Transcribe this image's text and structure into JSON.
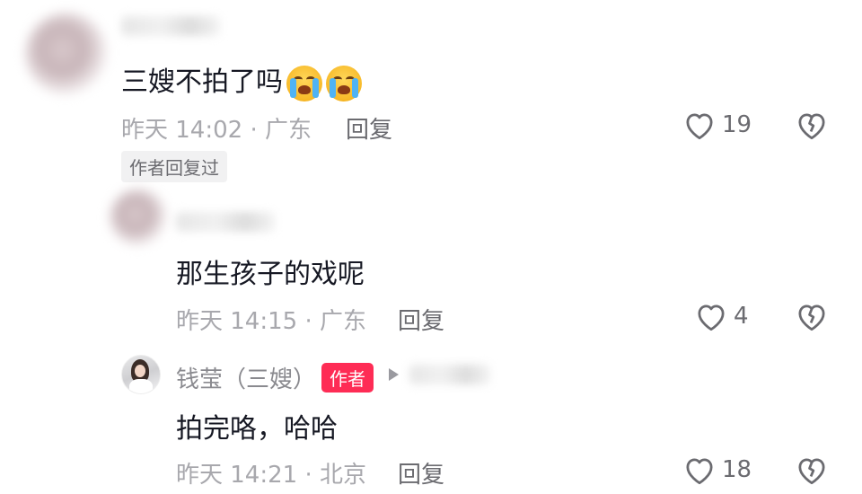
{
  "comments": [
    {
      "text": "三嫂不拍了吗",
      "emoji": [
        "loudly-crying-face",
        "loudly-crying-face"
      ],
      "meta": "昨天 14:02 · 广东",
      "reply_label": "回复",
      "likes": "19",
      "badge": "作者回复过"
    },
    {
      "text": "那生孩子的戏呢",
      "meta": "昨天 14:15 · 广东",
      "reply_label": "回复",
      "likes": "4"
    },
    {
      "author_name": "钱莹（三嫂）",
      "author_badge": "作者",
      "text": "拍完咯，哈哈",
      "meta": "昨天 14:21 · 北京",
      "reply_label": "回复",
      "likes": "18"
    }
  ],
  "colors": {
    "accent": "#fe2c55",
    "meta": "#a8a8ad",
    "icon": "#6b6b70"
  },
  "icons": {
    "like": "heart-outline-icon",
    "dislike": "broken-heart-icon"
  }
}
